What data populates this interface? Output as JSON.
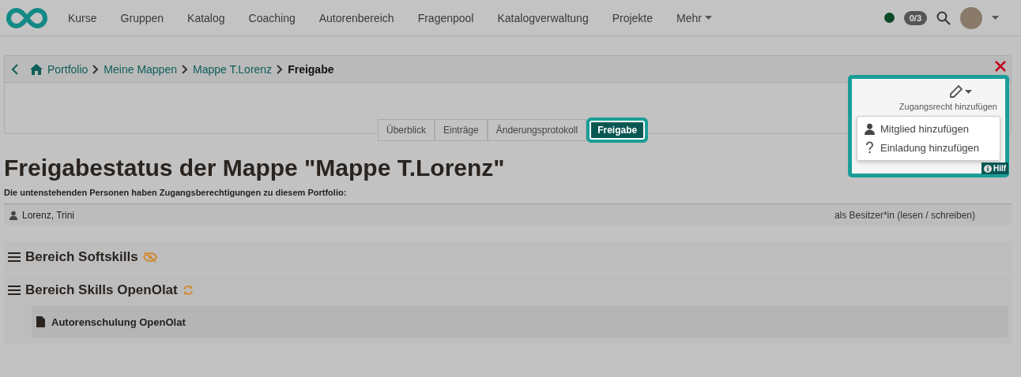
{
  "nav": {
    "items": [
      {
        "label": "Kurse",
        "has_caret": false
      },
      {
        "label": "Gruppen",
        "has_caret": false
      },
      {
        "label": "Katalog",
        "has_caret": false
      },
      {
        "label": "Coaching",
        "has_caret": false
      },
      {
        "label": "Autorenbereich",
        "has_caret": false
      },
      {
        "label": "Fragenpool",
        "has_caret": false
      },
      {
        "label": "Katalogverwaltung",
        "has_caret": false
      },
      {
        "label": "Projekte",
        "has_caret": false
      },
      {
        "label": "Mehr",
        "has_caret": true
      }
    ],
    "badge": "0/3"
  },
  "breadcrumb": [
    {
      "label": "Portfolio",
      "current": false
    },
    {
      "label": "Meine Mappen",
      "current": false
    },
    {
      "label": "Mappe T.Lorenz",
      "current": false
    },
    {
      "label": "Freigabe",
      "current": true
    }
  ],
  "tabs": [
    {
      "label": "Überblick",
      "selected": false
    },
    {
      "label": "Einträge",
      "selected": false
    },
    {
      "label": "Änderungsprotokoll",
      "selected": false
    },
    {
      "label": "Freigabe",
      "selected": true
    }
  ],
  "title": "Freigabestatus der Mappe \"Mappe T.Lorenz\"",
  "subtitle": "Die untenstehenden Personen haben Zugangsberechtigungen zu diesem Portfolio:",
  "members": [
    {
      "name": "Lorenz, Trini",
      "role": "als Besitzer*in (lesen / schreiben)"
    }
  ],
  "sections": [
    {
      "title": "Bereich Softskills",
      "kind": "hidden"
    },
    {
      "title": "Bereich Skills OpenOlat",
      "kind": "sync",
      "entries": [
        "Autorenschulung OpenOlat"
      ]
    }
  ],
  "help": "Hilf",
  "access_menu": {
    "label": "Zugangsrecht hinzufügen",
    "items": [
      {
        "kind": "member",
        "label": "Mitglied hinzufügen"
      },
      {
        "kind": "invite",
        "label": "Einladung hinzufügen"
      }
    ]
  }
}
